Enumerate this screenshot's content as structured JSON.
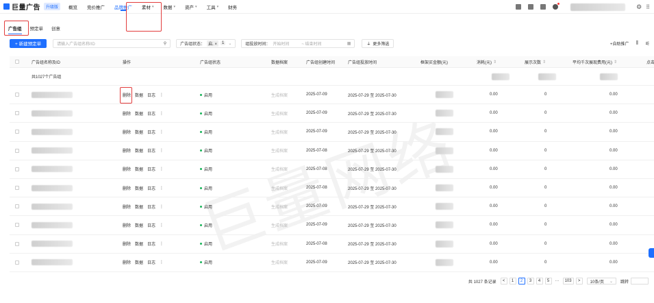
{
  "app": {
    "logo_text": "巨量广告",
    "upgrade_badge": "升级版"
  },
  "nav": [
    {
      "label": "概览",
      "caret": ""
    },
    {
      "label": "竞价推广",
      "caret": ""
    },
    {
      "label": "品牌推广",
      "caret": "",
      "active": true
    },
    {
      "label": "素材",
      "caret": "▾"
    },
    {
      "label": "数据",
      "caret": "▾"
    },
    {
      "label": "资产",
      "caret": "▾"
    },
    {
      "label": "工具",
      "caret": "▾"
    },
    {
      "label": "财务",
      "caret": ""
    }
  ],
  "subtabs": [
    {
      "label": "广告组",
      "active": true
    },
    {
      "label": "预定单"
    },
    {
      "label": "创意"
    }
  ],
  "toolbar": {
    "new_button": "+ 新建预定单",
    "search_placeholder": "请输入广告组名称/ID",
    "status_label": "广告组状态：",
    "status_tag": "启.",
    "status_tag_close": "×",
    "status_count": "1",
    "date_label": "组投放时间：",
    "date_start": "开始时间",
    "date_sep": "~ 结束时间",
    "more_filter": "更多筛选",
    "auto_promote": "自助推广"
  },
  "table": {
    "headers": [
      "广告组名称及ID",
      "操作",
      "广告组状态",
      "数据档案",
      "广告组创建时间",
      "广告组投放时间",
      "框架买金额(元)",
      "消耗(元)",
      "展示次数",
      "平均千次展现费用(元)",
      "点击"
    ],
    "summary": "共1027个广告组",
    "actions": [
      "删除",
      "数据",
      "日志",
      "⋮"
    ],
    "rows": [
      {
        "status": "启用",
        "archive": "生成档案",
        "created": "2025-07-09",
        "period": "2025-07-29 至 2025-07-30",
        "cost": "0.00",
        "impressions": "0",
        "cpm": "0.00"
      },
      {
        "status": "启用",
        "archive": "生成档案",
        "created": "2025-07-09",
        "period": "2025-07-29 至 2025-07-30",
        "cost": "0.00",
        "impressions": "0",
        "cpm": "0.00"
      },
      {
        "status": "启用",
        "archive": "生成档案",
        "created": "2025-07-09",
        "period": "2025-07-29 至 2025-07-30",
        "cost": "0.00",
        "impressions": "0",
        "cpm": "0.00"
      },
      {
        "status": "启用",
        "archive": "生成档案",
        "created": "2025-07-08",
        "period": "2025-07-29 至 2025-07-30",
        "cost": "0.00",
        "impressions": "0",
        "cpm": "0.00"
      },
      {
        "status": "启用",
        "archive": "生成档案",
        "created": "2025-07-08",
        "period": "2025-07-29 至 2025-07-30",
        "cost": "0.00",
        "impressions": "0",
        "cpm": "0.00"
      },
      {
        "status": "启用",
        "archive": "生成档案",
        "created": "2025-07-08",
        "period": "2025-07-29 至 2025-07-30",
        "cost": "0.00",
        "impressions": "0",
        "cpm": "0.00"
      },
      {
        "status": "启用",
        "archive": "生成档案",
        "created": "2025-07-09",
        "period": "2025-07-29 至 2025-07-30",
        "cost": "0.00",
        "impressions": "0",
        "cpm": "0.00"
      },
      {
        "status": "启用",
        "archive": "生成档案",
        "created": "2025-07-09",
        "period": "2025-07-29 至 2025-07-30",
        "cost": "0.00",
        "impressions": "0",
        "cpm": "0.00"
      },
      {
        "status": "启用",
        "archive": "生成档案",
        "created": "2025-07-08",
        "period": "2025-07-29 至 2025-07-30",
        "cost": "0.00",
        "impressions": "0",
        "cpm": "0.00"
      },
      {
        "status": "启用",
        "archive": "生成档案",
        "created": "2025-07-09",
        "period": "2025-07-29 至 2025-07-30",
        "cost": "0.00",
        "impressions": "0",
        "cpm": "0.00"
      }
    ]
  },
  "pagination": {
    "total": "共 1027 条记录",
    "prev": "<",
    "pages": [
      "1",
      "2",
      "3",
      "4",
      "5",
      "···",
      "103"
    ],
    "active_page": "2",
    "next": ">",
    "page_size": "10条/页",
    "jump_label": "跳转"
  },
  "watermark": "巨量网络",
  "colors": {
    "accent": "#1e6fff",
    "status_green": "#19b45a",
    "highlight_red": "#e23c3c"
  }
}
